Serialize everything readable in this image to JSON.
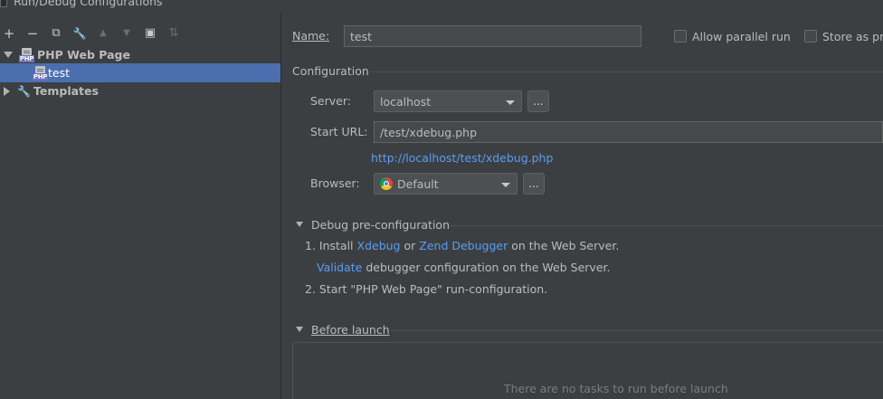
{
  "window": {
    "title": "Run/Debug Configurations"
  },
  "toolbar": {
    "add": "+",
    "remove": "−",
    "copy": "⧉",
    "edit_defaults": "🔧",
    "move_up": "▲",
    "move_down": "▼",
    "new_folder": "▣",
    "sort": "⇅"
  },
  "tree": {
    "group_label": "PHP Web Page",
    "config_label": "test",
    "templates_label": "Templates",
    "php_icon_text": "PHP"
  },
  "form": {
    "name_label": "Name:",
    "name_value": "test",
    "allow_parallel_label": "Allow parallel run",
    "store_as_label": "Store as pro",
    "configuration_header": "Configuration",
    "server_label": "Server:",
    "server_value": "localhost",
    "ellipsis": "...",
    "start_url_label": "Start URL:",
    "start_url_value": "/test/xdebug.php",
    "full_url_link": "http://localhost/test/xdebug.php",
    "browser_label": "Browser:",
    "browser_value": "Default"
  },
  "debug_preconfig": {
    "header": "Debug pre-configuration",
    "step1_prefix": "1. Install",
    "xdebug_link": "Xdebug",
    "or_text": "or",
    "zend_link": "Zend Debugger",
    "step1_suffix": "on the Web Server.",
    "validate_link": "Validate",
    "validate_suffix": "debugger configuration on the Web Server.",
    "step2": "2. Start \"PHP Web Page\" run-configuration."
  },
  "before_launch": {
    "header": "Before launch",
    "empty_text": "There are no tasks to run before launch"
  },
  "colors": {
    "background": "#3c3f41",
    "selection": "#4b6eaf",
    "link": "#589df6",
    "text": "#bbbbbb"
  }
}
